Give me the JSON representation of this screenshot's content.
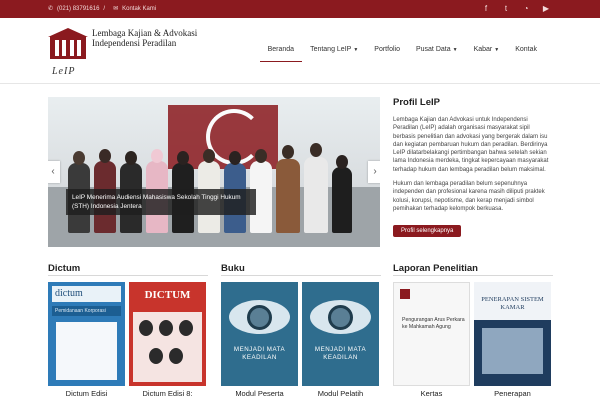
{
  "topbar": {
    "phone": "(021) 83791616",
    "separator": "/",
    "contact_label": "Kontak Kami",
    "social": [
      "facebook-icon",
      "twitter-icon",
      "rss-icon",
      "youtube-icon"
    ]
  },
  "logo": {
    "line1": "Lembaga Kajian & Advokasi",
    "line2": "Independensi Peradilan",
    "abbr": "LeIP"
  },
  "nav": {
    "items": [
      {
        "label": "Beranda",
        "dropdown": false
      },
      {
        "label": "Tentang LeIP",
        "dropdown": true
      },
      {
        "label": "Portfolio",
        "dropdown": false
      },
      {
        "label": "Pusat Data",
        "dropdown": true
      },
      {
        "label": "Kabar",
        "dropdown": true
      },
      {
        "label": "Kontak",
        "dropdown": false
      }
    ]
  },
  "slider": {
    "caption": "LeIP Menerima Audiensi Mahasiswa Sekolah Tinggi Hukum (STH) Indonesia Jentera",
    "prev": "‹",
    "next": "›"
  },
  "profile": {
    "title": "Profil LeIP",
    "para1": "Lembaga Kajian dan Advokasi untuk Independensi Peradilan (LeIP) adalah organisasi masyarakat sipil berbasis penelitian dan advokasi yang bergerak dalam isu dan kegiatan pembaruan hukum dan peradilan. Berdirinya LeIP dilatarbelakangi pertimbangan bahwa setelah sekian lama Indonesia merdeka, tingkat kepercayaan masyarakat terhadap hukum dan lembaga peradilan belum maksimal.",
    "para2": "Hukum dan lembaga peradilan belum sepenuhnya independen dan profesional karena masih diliputi praktek kolusi, korupsi, nepotisme, dan kerap menjadi simbol pemihakan terhadap kelompok berkuasa.",
    "button": "Profil selengkapnya"
  },
  "sections": {
    "dictum": {
      "title": "Dictum",
      "cards": [
        {
          "title": "Dictum Edisi",
          "cover_top": "dictum",
          "cover_sub": "Pemidanaan Korporasi"
        },
        {
          "title": "Dictum Edisi 8:",
          "cover_top": "DICTUM"
        }
      ]
    },
    "buku": {
      "title": "Buku",
      "cards": [
        {
          "title": "Modul Peserta",
          "cover_text": "MENJADI MATA KEADILAN"
        },
        {
          "title": "Modul Pelatih",
          "cover_text": "MENJADI MATA KEADILAN"
        }
      ]
    },
    "laporan": {
      "title": "Laporan Penelitian",
      "cards": [
        {
          "title": "Kertas",
          "cover_text": "Pengurangan Arus Perkara ke Mahkamah Agung"
        },
        {
          "title": "Penerapan",
          "cover_text": "PENERAPAN SISTEM KAMAR"
        }
      ]
    }
  },
  "colors": {
    "brand": "#8b1a1f",
    "topbar": "#8b1a1f"
  }
}
